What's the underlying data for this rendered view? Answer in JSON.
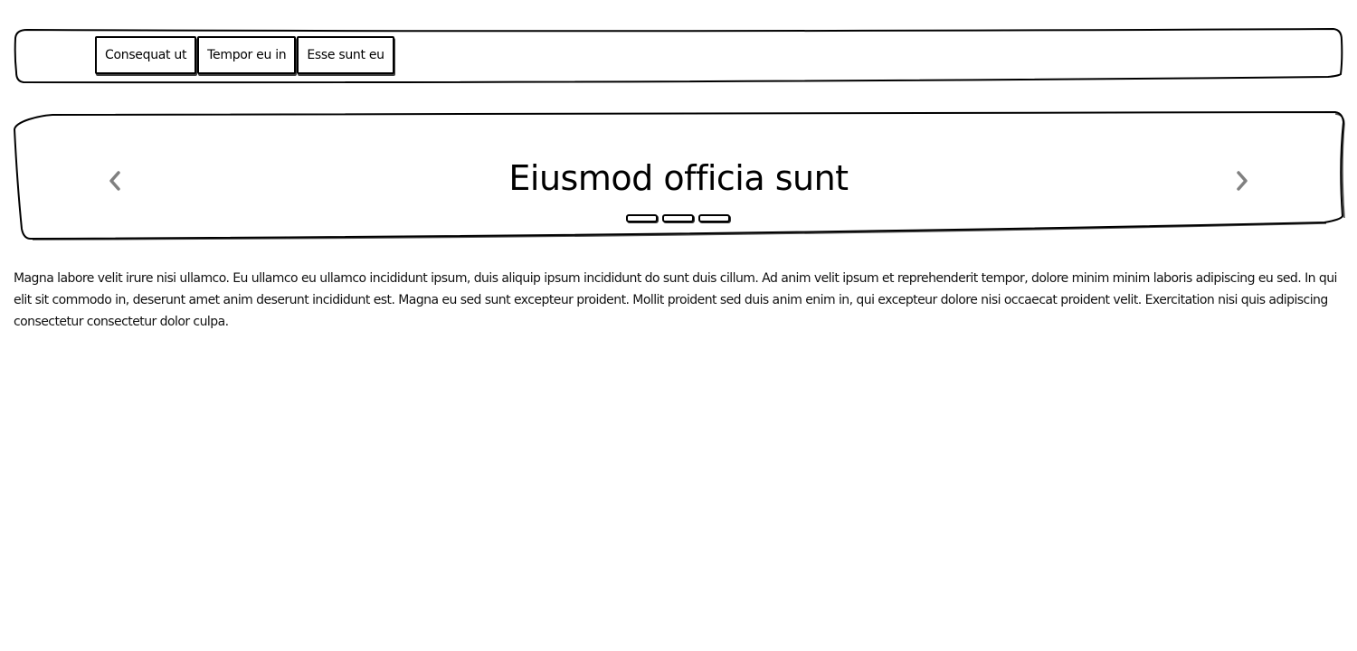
{
  "navbar": {
    "items": [
      {
        "label": "Consequat ut"
      },
      {
        "label": "Tempor eu in"
      },
      {
        "label": "Esse sunt eu"
      }
    ]
  },
  "carousel": {
    "title": "Eiusmod officia sunt",
    "prev_icon": "chevron-left-icon",
    "next_icon": "chevron-right-icon",
    "slide_count": 3,
    "arrow_color": "#808080"
  },
  "content": {
    "paragraph": "Magna labore velit irure nisi ullamco. Eu ullamco eu ullamco incididunt ipsum, duis aliquip ipsum incididunt do sunt duis cillum. Ad anim velit ipsum et reprehenderit tempor, dolore minim minim laboris adipiscing eu sed. In qui elit sit commodo in, deserunt amet anim deserunt incididunt est. Magna eu sed sunt excepteur proident. Mollit proident sed duis anim enim in, qui excepteur dolore nisi occaecat proident velit. Exercitation nisi quis adipiscing consectetur consectetur dolor culpa."
  }
}
